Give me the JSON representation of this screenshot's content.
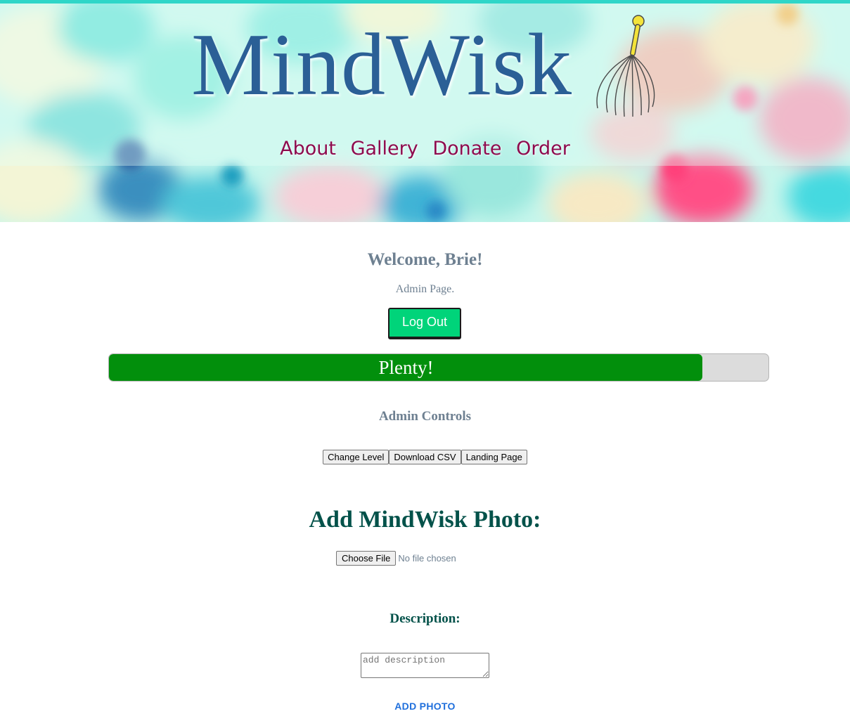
{
  "header": {
    "logo": "MindWisk",
    "nav": [
      {
        "label": "About"
      },
      {
        "label": "Gallery"
      },
      {
        "label": "Donate"
      },
      {
        "label": "Order"
      }
    ]
  },
  "welcome": {
    "greeting": "Welcome, Brie!",
    "subtitle": "Admin Page.",
    "logout_label": "Log Out"
  },
  "progress": {
    "label": "Plenty!",
    "fraction": 0.9
  },
  "admin": {
    "title": "Admin Controls",
    "buttons": [
      {
        "label": "Change Level"
      },
      {
        "label": "Download CSV"
      },
      {
        "label": "Landing Page"
      }
    ]
  },
  "photo": {
    "title": "Add MindWisk Photo:",
    "file_button": "Choose File",
    "file_status": "No file chosen",
    "description_title": "Description:",
    "description_placeholder": "add description",
    "submit_label": "ADD PHOTO"
  },
  "colors": {
    "accent_green": "#00d47a",
    "progress_green": "#028f0c",
    "nav_magenta": "#8e0b4e",
    "logo_blue": "#2b5f96",
    "heading_teal": "#04524a",
    "muted_text": "#6e8091",
    "link_blue": "#1f6fdc"
  }
}
